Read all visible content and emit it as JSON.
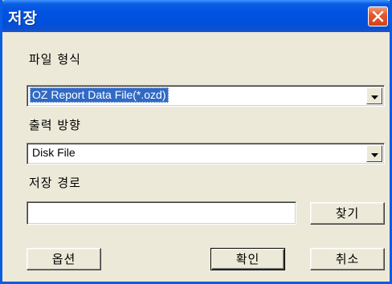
{
  "window": {
    "title": "저장"
  },
  "file_format": {
    "label": "파일 형식",
    "selected": "OZ Report Data File(*.ozd)"
  },
  "output_direction": {
    "label": "출력 방향",
    "selected": "Disk File"
  },
  "save_path": {
    "label": "저장 경로",
    "value": "",
    "browse_label": "찾기"
  },
  "buttons": {
    "options": "옵션",
    "ok": "확인",
    "cancel": "취소"
  },
  "icons": {
    "close": "close-icon",
    "dropdown": "dropdown-arrow-icon"
  },
  "colors": {
    "titlebar": "#0a5ce2",
    "selection": "#316ac5",
    "close_button": "#e4592f",
    "dialog_face": "#ece9d8"
  }
}
